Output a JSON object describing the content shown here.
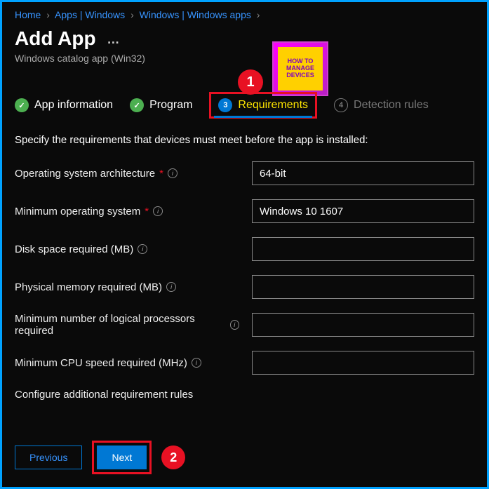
{
  "breadcrumb": {
    "items": [
      "Home",
      "Apps | Windows",
      "Windows | Windows apps"
    ]
  },
  "header": {
    "title": "Add App",
    "subtitle": "Windows catalog app (Win32)"
  },
  "logo": {
    "line1": "HOW TO",
    "line2": "MANAGE",
    "line3": "DEVICES"
  },
  "callouts": {
    "one": "1",
    "two": "2"
  },
  "steps": {
    "s1": "App information",
    "s2": "Program",
    "s3": "Requirements",
    "s4": "Detection rules",
    "num3": "3",
    "num4": "4"
  },
  "intro": "Specify the requirements that devices must meet before the app is installed:",
  "form": {
    "os_arch": {
      "label": "Operating system architecture",
      "value": "64-bit"
    },
    "min_os": {
      "label": "Minimum operating system",
      "value": "Windows 10 1607"
    },
    "disk": {
      "label": "Disk space required (MB)",
      "value": ""
    },
    "mem": {
      "label": "Physical memory required (MB)",
      "value": ""
    },
    "procs": {
      "label": "Minimum number of logical processors required",
      "value": ""
    },
    "cpu": {
      "label": "Minimum CPU speed required (MHz)",
      "value": ""
    },
    "config": "Configure additional requirement rules"
  },
  "buttons": {
    "prev": "Previous",
    "next": "Next"
  }
}
